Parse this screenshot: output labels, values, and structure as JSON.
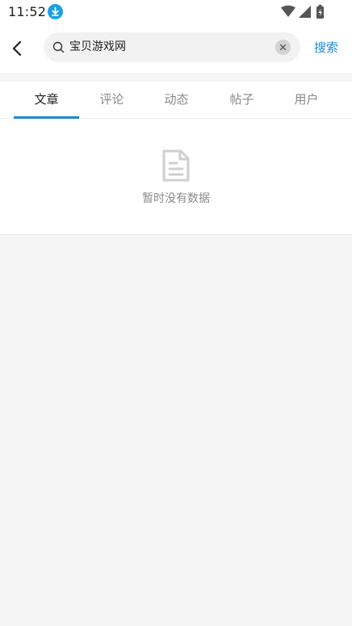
{
  "status_bar": {
    "time": "11:52",
    "icons": [
      "download-icon",
      "wifi-icon",
      "signal-icon",
      "battery-charging-icon"
    ]
  },
  "header": {
    "search_value": "宝贝游戏网",
    "search_button_label": "搜索",
    "icons": [
      "back-icon",
      "search-icon",
      "clear-icon"
    ]
  },
  "tabs": [
    {
      "label": "文章",
      "active": true
    },
    {
      "label": "评论",
      "active": false
    },
    {
      "label": "动态",
      "active": false
    },
    {
      "label": "帖子",
      "active": false
    },
    {
      "label": "用户",
      "active": false
    }
  ],
  "empty_state": {
    "icon": "document-icon",
    "message": "暂时没有数据"
  },
  "colors": {
    "accent": "#1a8ad6",
    "download_badge": "#1aa0e6",
    "background": "#f5f5f5"
  }
}
